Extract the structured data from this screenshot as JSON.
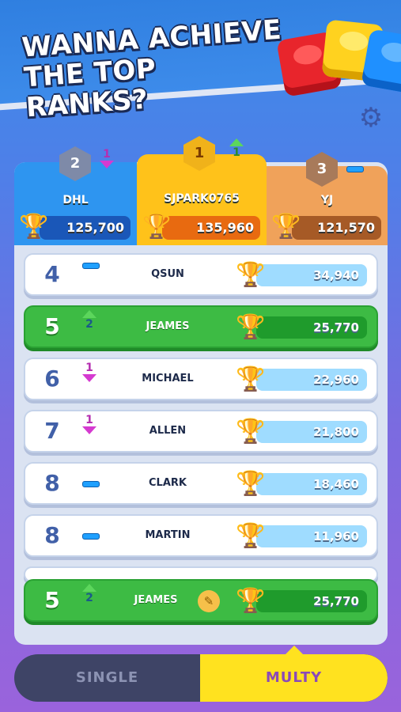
{
  "headline": {
    "line1": "WANNA ACHIEVE",
    "line2": "THE TOP RANKS?"
  },
  "icons": {
    "settings": "gear-icon",
    "trophy": "trophy-icon",
    "pencil": "pencil-icon"
  },
  "podium": [
    {
      "rank": "2",
      "name": "DHL",
      "score": "125,700",
      "change": "1",
      "direction": "down"
    },
    {
      "rank": "1",
      "name": "SJPARK0765",
      "score": "135,960",
      "change": "1",
      "direction": "up"
    },
    {
      "rank": "3",
      "name": "YJ",
      "score": "121,570",
      "change": "",
      "direction": "same"
    }
  ],
  "rows": [
    {
      "rank": "4",
      "change": "",
      "direction": "same",
      "name": "QSUN",
      "score": "34,940",
      "highlight": false
    },
    {
      "rank": "5",
      "change": "2",
      "direction": "up",
      "name": "JEAMES",
      "score": "25,770",
      "highlight": true
    },
    {
      "rank": "6",
      "change": "1",
      "direction": "down",
      "name": "MICHAEL",
      "score": "22,960",
      "highlight": false
    },
    {
      "rank": "7",
      "change": "1",
      "direction": "down",
      "name": "ALLEN",
      "score": "21,800",
      "highlight": false
    },
    {
      "rank": "8",
      "change": "",
      "direction": "same",
      "name": "CLARK",
      "score": "18,460",
      "highlight": false
    },
    {
      "rank": "8",
      "change": "",
      "direction": "same",
      "name": "MARTIN",
      "score": "11,960",
      "highlight": false
    }
  ],
  "current_player": {
    "rank": "5",
    "change": "2",
    "direction": "up",
    "name": "JEAMES",
    "score": "25,770"
  },
  "tabs": {
    "single": "SINGLE",
    "multy": "MULTY",
    "active": "multy"
  },
  "colors": {
    "highlight_row": "#3dbb44",
    "active_tab": "#ffe21f",
    "gold": "#ffc21a"
  }
}
